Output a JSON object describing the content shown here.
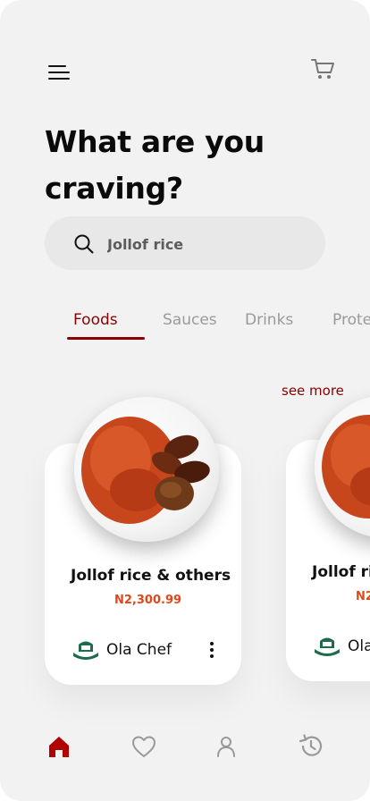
{
  "header": {
    "menu_icon": "hamburger-menu-icon",
    "cart_icon": "cart-icon",
    "headline_line1": "What are you",
    "headline_line2": "craving?"
  },
  "search": {
    "icon": "search-icon",
    "value": "Jollof rice",
    "placeholder": "Jollof rice"
  },
  "tabs": [
    {
      "label": "Foods",
      "active": true
    },
    {
      "label": "Sauces",
      "active": false
    },
    {
      "label": "Drinks",
      "active": false
    },
    {
      "label": "Prote",
      "active": false
    }
  ],
  "see_more_label": "see more",
  "cards": [
    {
      "title": "Jollof rice & others",
      "price": "N2,300.99",
      "chef": "Ola Chef",
      "chef_logo_text": "OLACHEF"
    },
    {
      "title": "Jollof ri",
      "price": "N2",
      "chef": "Ola",
      "chef_logo_text": "OLACHEF"
    }
  ],
  "bottom_nav": [
    {
      "name": "home",
      "icon": "home-icon",
      "active": true
    },
    {
      "name": "favorites",
      "icon": "heart-icon",
      "active": false
    },
    {
      "name": "profile",
      "icon": "user-icon",
      "active": false
    },
    {
      "name": "history",
      "icon": "history-icon",
      "active": false
    }
  ],
  "colors": {
    "accent": "#8b0000",
    "price": "#e0471a",
    "background": "#f2f2f2",
    "card": "#ffffff",
    "tab_inactive": "#9a9a9a"
  }
}
